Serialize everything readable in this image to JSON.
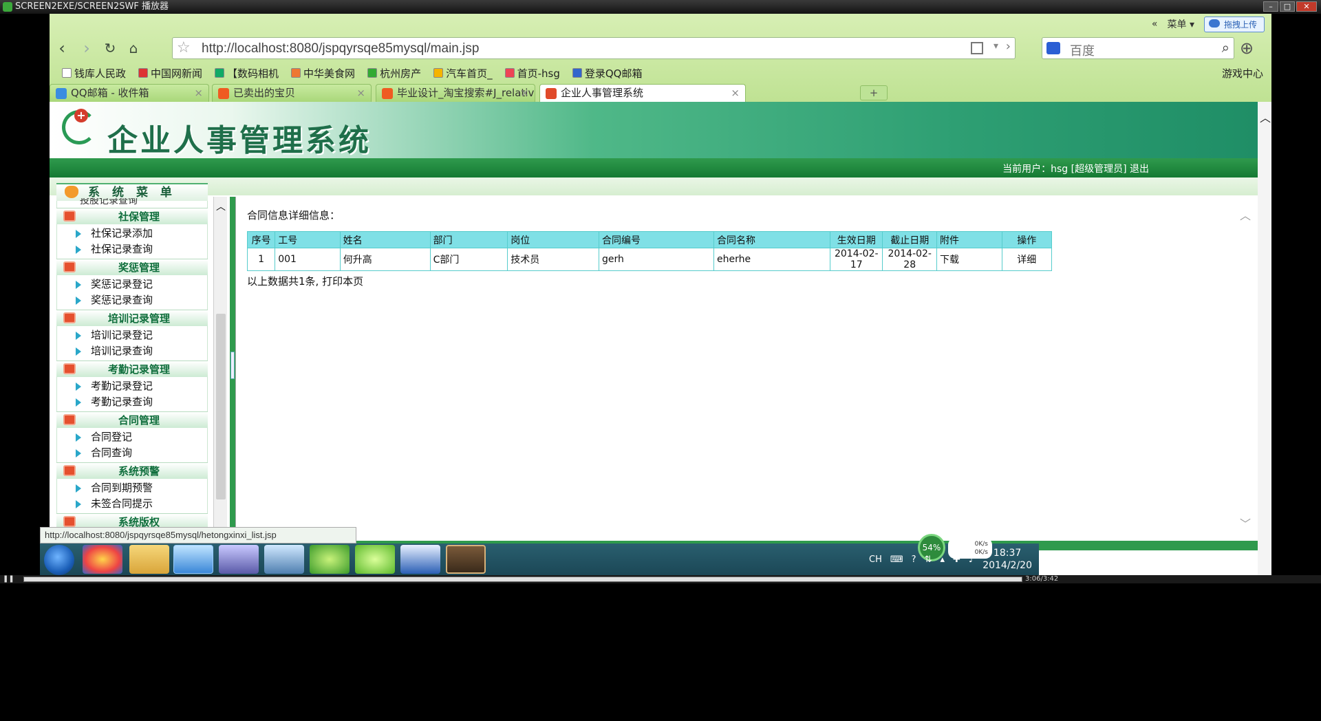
{
  "player": {
    "title": "SCREEN2EXE/SCREEN2SWF 播放器",
    "time_code": "3:06/3:42"
  },
  "browser": {
    "menu_label": "菜单",
    "upload_label": "拖拽上传",
    "url": "http://localhost:8080/jspqyrsqe85mysql/main.jsp",
    "search_placeholder": "百度",
    "bookmarks": [
      {
        "label": "钱库人民政",
        "color": "#ffffff"
      },
      {
        "label": "中国网新闻",
        "color": "#d33"
      },
      {
        "label": "【数码相机",
        "color": "#1a6"
      },
      {
        "label": "中华美食网",
        "color": "#e73"
      },
      {
        "label": "杭州房产",
        "color": "#3a3"
      },
      {
        "label": "汽车首页_",
        "color": "#f5b400"
      },
      {
        "label": "首页-hsg",
        "color": "#e45"
      },
      {
        "label": "登录QQ邮箱",
        "color": "#36c"
      }
    ],
    "bookmark_right": "游戏中心",
    "tabs": [
      {
        "label": "QQ邮箱 - 收件箱",
        "color": "#3a8de0"
      },
      {
        "label": "已卖出的宝贝",
        "color": "#ef5b22"
      },
      {
        "label": "毕业设计_淘宝搜索#J_relative#J",
        "color": "#ef5b22"
      },
      {
        "label": "企业人事管理系统",
        "color": "#e04a2a"
      }
    ],
    "status_url": "http://localhost:8080/jspqyrsqe85mysql/hetongxinxi_list.jsp"
  },
  "app": {
    "title": "企业人事管理系统",
    "current_user": "当前用户：hsg [超级管理员] 退出",
    "sidebar_title": "系 统 菜 单",
    "sidebar_cut": "投股记录查询",
    "menu": [
      {
        "group": "社保管理",
        "items": [
          "社保记录添加",
          "社保记录查询"
        ]
      },
      {
        "group": "奖惩管理",
        "items": [
          "奖惩记录登记",
          "奖惩记录查询"
        ]
      },
      {
        "group": "培训记录管理",
        "items": [
          "培训记录登记",
          "培训记录查询"
        ]
      },
      {
        "group": "考勤记录管理",
        "items": [
          "考勤记录登记",
          "考勤记录查询"
        ]
      },
      {
        "group": "合同管理",
        "items": [
          "合同登记",
          "合同查询"
        ]
      },
      {
        "group": "系统预警",
        "items": [
          "合同到期预警",
          "未签合同提示"
        ]
      },
      {
        "group": "系统版权",
        "items": []
      }
    ],
    "content_title": "合同信息详细信息：",
    "table": {
      "headers": [
        "序号",
        "工号",
        "姓名",
        "部门",
        "岗位",
        "合同编号",
        "合同名称",
        "生效日期",
        "截止日期",
        "附件",
        "操作"
      ],
      "rows": [
        [
          "1",
          "001",
          "何升高",
          "C部门",
          "技术员",
          "gerh",
          "eherhe",
          "2014-02-17",
          "2014-02-28",
          "下载",
          "详细"
        ]
      ]
    },
    "summary": "以上数据共1条, 打印本页"
  },
  "taskbar": {
    "ime": "CH",
    "gauge": "54%",
    "net_up": "0K/s",
    "net_down": "0K/s",
    "time": "18:37",
    "date": "2014/2/20"
  }
}
